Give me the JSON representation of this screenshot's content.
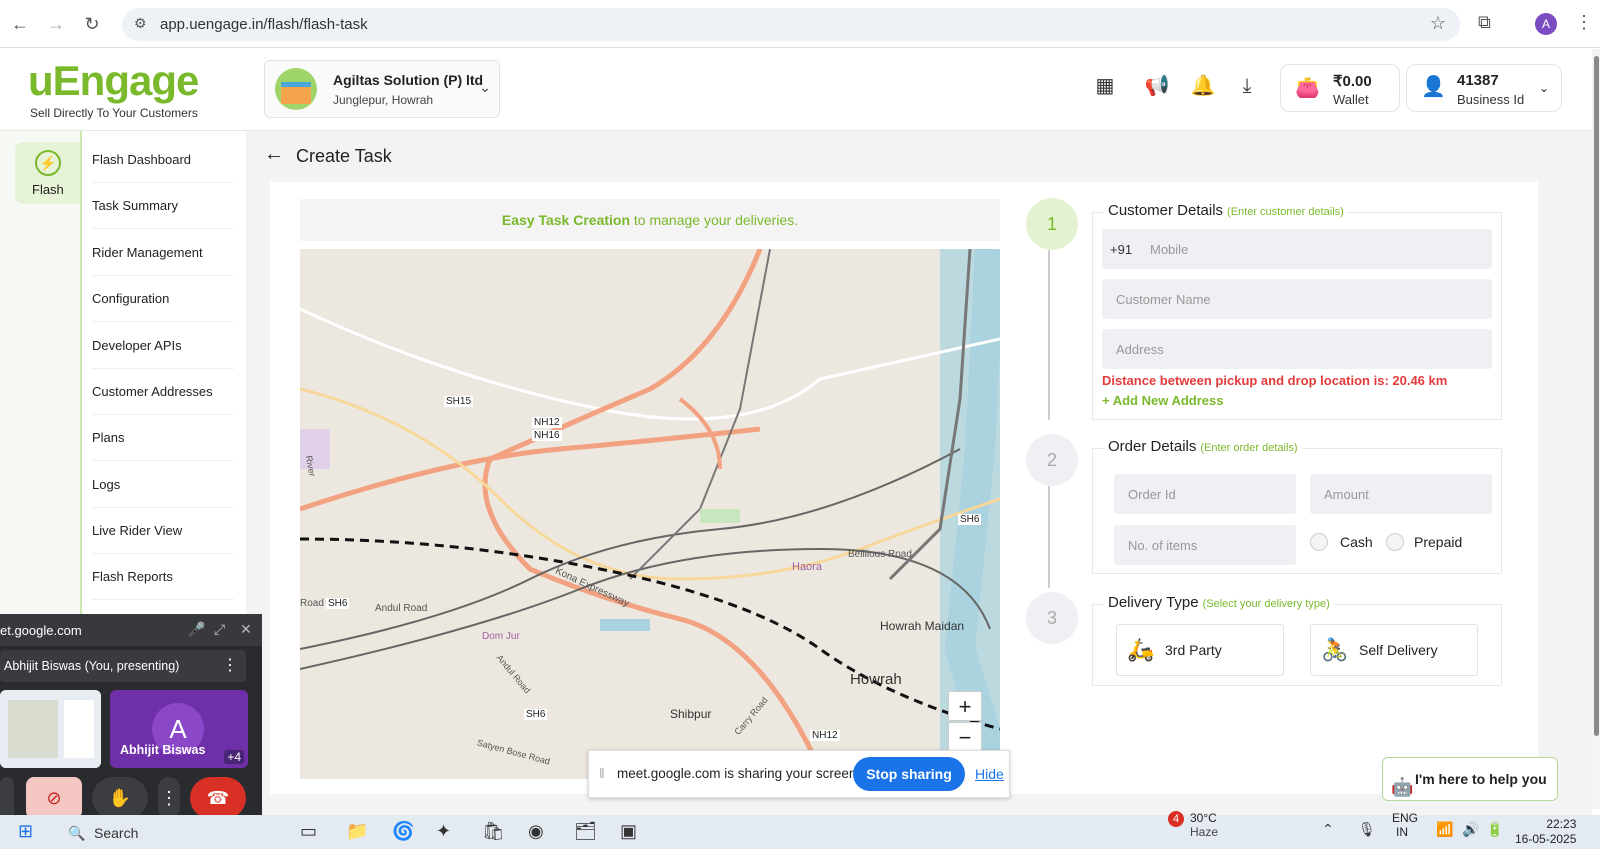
{
  "browser": {
    "url": "app.uengage.in/flash/flash-task",
    "profile_initial": "A"
  },
  "header": {
    "logo": "uEngage",
    "tagline": "Sell Directly To Your Customers",
    "business_name": "Agiltas Solution (P) ltd",
    "business_location": "Junglepur, Howrah",
    "wallet_amount": "₹0.00",
    "wallet_label": "Wallet",
    "business_id": "41387",
    "business_id_label": "Business Id"
  },
  "rail": {
    "flash_label": "Flash"
  },
  "sidebar": {
    "items": [
      {
        "label": "Flash Dashboard"
      },
      {
        "label": "Task Summary"
      },
      {
        "label": "Rider Management"
      },
      {
        "label": "Configuration"
      },
      {
        "label": "Developer APIs"
      },
      {
        "label": "Customer Addresses"
      },
      {
        "label": "Plans"
      },
      {
        "label": "Logs"
      },
      {
        "label": "Live Rider View"
      },
      {
        "label": "Flash Reports"
      }
    ]
  },
  "page": {
    "title": "Create Task",
    "banner_bold": "Easy Task Creation",
    "banner_rest": " to manage your deliveries."
  },
  "map": {
    "labels": [
      "SH15",
      "NH12",
      "NH16",
      "SH6",
      "SH6",
      "Andul Road",
      "Kona Expressway",
      "Belilious Road",
      "Haora",
      "Howrah Maidan",
      "Howrah",
      "Shibpur",
      "SH6",
      "NH12",
      "Road",
      "Andul Road",
      "Carry Road",
      "Satyen Bose Road",
      "Dom Jur",
      "River"
    ],
    "zoom_in": "+",
    "zoom_out": "−"
  },
  "steps": {
    "customer": {
      "number": "1",
      "title": "Customer Details",
      "hint": "(Enter customer details)",
      "country_code": "+91",
      "mobile_placeholder": "Mobile",
      "name_placeholder": "Customer Name",
      "address_placeholder": "Address",
      "distance_error": "Distance between pickup and drop location is: 20.46 km",
      "add_address": "+ Add New Address"
    },
    "order": {
      "number": "2",
      "title": "Order Details",
      "hint": "(Enter order details)",
      "order_id_placeholder": "Order Id",
      "amount_placeholder": "Amount",
      "items_placeholder": "No. of items",
      "cash_label": "Cash",
      "prepaid_label": "Prepaid"
    },
    "delivery": {
      "number": "3",
      "title": "Delivery Type",
      "hint": "(Select your delivery type)",
      "third_party": "3rd Party",
      "self_delivery": "Self Delivery"
    }
  },
  "helper": {
    "label": "I'm here to help you"
  },
  "meet": {
    "site": "et.google.com",
    "presenter": "Abhijit Biswas (You, presenting)",
    "avatar_initial": "A",
    "participant": "Abhijit Biswas",
    "extra_count": "+4"
  },
  "share_bar": {
    "text": "meet.google.com is sharing your screen.",
    "stop": "Stop sharing",
    "hide": "Hide"
  },
  "taskbar": {
    "search": "Search",
    "weather_badge": "4",
    "temp": "30°C",
    "condition": "Haze",
    "lang": "ENG",
    "region": "IN",
    "time": "22:23",
    "date": "16-05-2025"
  },
  "colors": {
    "brand": "#7ab92c",
    "error": "#e23b3b",
    "share_blue": "#1a73e8"
  }
}
